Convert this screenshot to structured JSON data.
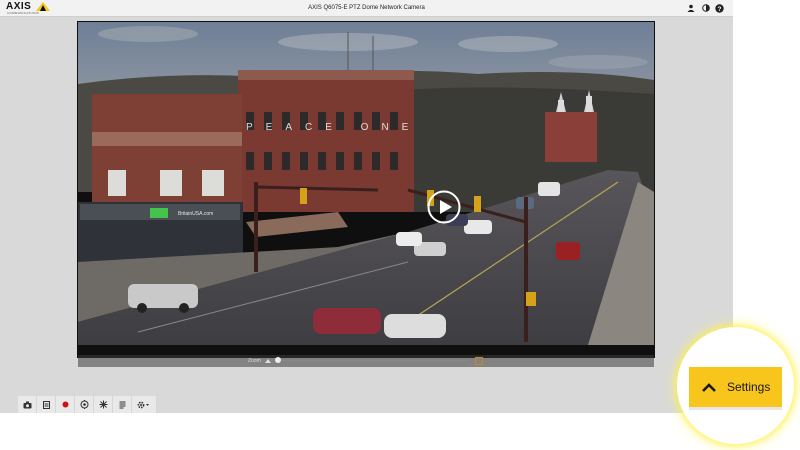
{
  "header": {
    "logo_text": "AXIS",
    "logo_subtext": "COMMUNICATIONS",
    "camera_title": "AXIS Q6075-E PTZ Dome Network Camera",
    "icons": [
      "user-icon",
      "contrast-icon",
      "help-icon"
    ]
  },
  "video": {
    "building_sign": "PEACE ONE",
    "storefront_sign": "BritainUSA.com",
    "zoom_label": "Zoom",
    "zoom_level": 0.0
  },
  "toolbar": {
    "icons": [
      "camera-snapshot-icon",
      "save-icon",
      "record-icon",
      "ptz-icon",
      "focus-icon",
      "stream-icon",
      "settings-gear-dropdown-icon"
    ]
  },
  "settings": {
    "label": "Settings"
  },
  "colors": {
    "accent": "#f7c51c",
    "record": "#d0101a",
    "background": "#d9d9d9"
  }
}
